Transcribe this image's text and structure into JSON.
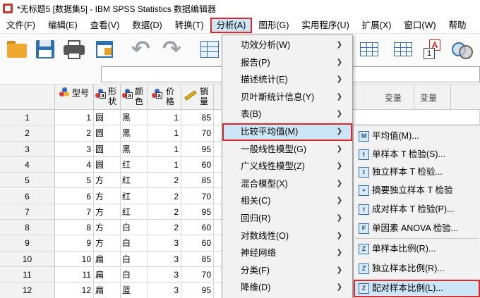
{
  "window": {
    "title": "*无标题5 [数据集5] - IBM SPSS Statistics 数据编辑器"
  },
  "menubar": [
    {
      "label": "文件(F)"
    },
    {
      "label": "编辑(E)"
    },
    {
      "label": "查看(V)"
    },
    {
      "label": "数据(D)"
    },
    {
      "label": "转换(T)"
    },
    {
      "label": "分析(A)"
    },
    {
      "label": "图形(G)"
    },
    {
      "label": "实用程序(U)"
    },
    {
      "label": "扩展(X)"
    },
    {
      "label": "窗口(W)"
    },
    {
      "label": "帮助"
    }
  ],
  "toolbar": {
    "value_labels_glyph": "A",
    "value_labels_glyph2": "1"
  },
  "grid": {
    "columns": [
      {
        "name": "型号",
        "icon": "nominal-numeric-icon"
      },
      {
        "name": "形状",
        "icon": "nominal-string-icon"
      },
      {
        "name": "颜色",
        "icon": "nominal-string-icon"
      },
      {
        "name": "价格",
        "icon": "nominal-string-icon"
      },
      {
        "name": "销量",
        "icon": "scale-ruler-icon"
      }
    ],
    "extra_headers": [
      "变量",
      "变量"
    ],
    "rows": [
      {
        "n": "1",
        "xh": "1",
        "xz": "圆",
        "ys": "黑",
        "jg": "1",
        "xl": "85"
      },
      {
        "n": "2",
        "xh": "2",
        "xz": "圆",
        "ys": "黑",
        "jg": "1",
        "xl": "70"
      },
      {
        "n": "3",
        "xh": "3",
        "xz": "圆",
        "ys": "黑",
        "jg": "1",
        "xl": "95"
      },
      {
        "n": "4",
        "xh": "4",
        "xz": "圆",
        "ys": "红",
        "jg": "1",
        "xl": "60"
      },
      {
        "n": "5",
        "xh": "5",
        "xz": "方",
        "ys": "红",
        "jg": "2",
        "xl": "85"
      },
      {
        "n": "6",
        "xh": "6",
        "xz": "方",
        "ys": "红",
        "jg": "2",
        "xl": "70"
      },
      {
        "n": "7",
        "xh": "7",
        "xz": "方",
        "ys": "红",
        "jg": "2",
        "xl": "95"
      },
      {
        "n": "8",
        "xh": "8",
        "xz": "方",
        "ys": "白",
        "jg": "2",
        "xl": "60"
      },
      {
        "n": "9",
        "xh": "9",
        "xz": "方",
        "ys": "白",
        "jg": "3",
        "xl": "60"
      },
      {
        "n": "10",
        "xh": "10",
        "xz": "扁",
        "ys": "白",
        "jg": "3",
        "xl": "85"
      },
      {
        "n": "11",
        "xh": "11",
        "xz": "扁",
        "ys": "白",
        "jg": "3",
        "xl": "70"
      },
      {
        "n": "12",
        "xh": "12",
        "xz": "扁",
        "ys": "蓝",
        "jg": "3",
        "xl": "95"
      }
    ]
  },
  "analyze_menu": [
    {
      "label": "功效分析(W)"
    },
    {
      "label": "报告(P)"
    },
    {
      "label": "描述统计(E)"
    },
    {
      "label": "贝叶斯统计信息(Y)"
    },
    {
      "label": "表(B)"
    },
    {
      "label": "比较平均值(M)"
    },
    {
      "label": "一般线性模型(G)"
    },
    {
      "label": "广义线性模型(Z)"
    },
    {
      "label": "混合模型(X)"
    },
    {
      "label": "相关(C)"
    },
    {
      "label": "回归(R)"
    },
    {
      "label": "对数线性(O)"
    },
    {
      "label": "神经网络"
    },
    {
      "label": "分类(F)"
    },
    {
      "label": "降维(D)"
    }
  ],
  "compare_means_menu": [
    {
      "label": "平均值(M)...",
      "glyph": "M"
    },
    {
      "label": "单样本 T 检验(S)...",
      "glyph": "t"
    },
    {
      "label": "独立样本 T 检验...",
      "glyph": "t"
    },
    {
      "label": "摘要独立样本 T 检验",
      "glyph": "+"
    },
    {
      "label": "成对样本 T 检验(P)...",
      "glyph": "t"
    },
    {
      "label": "单因素 ANOVA 检验...",
      "glyph": "F"
    },
    {
      "label": "单样本比例(R)...",
      "glyph": "Z"
    },
    {
      "label": "独立样本比例(R)...",
      "glyph": "Z"
    },
    {
      "label": "配对样本比例(L)...",
      "glyph": "Z"
    }
  ],
  "colors": {
    "highlight": "#cde6f7",
    "callout_red": "#e0282a"
  }
}
